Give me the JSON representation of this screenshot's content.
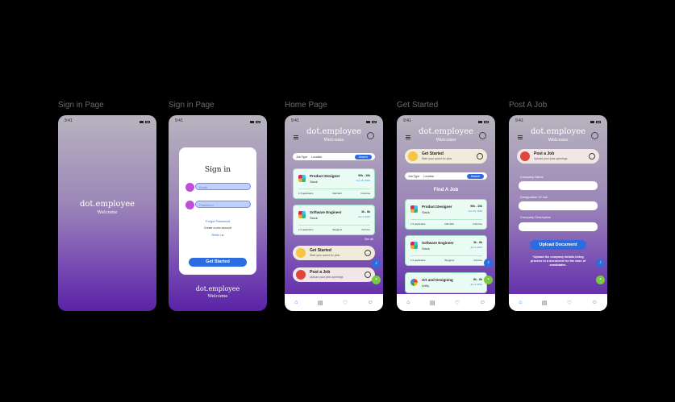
{
  "frames": [
    {
      "title": "Sign in Page"
    },
    {
      "title": "Sign in Page"
    },
    {
      "title": "Home Page"
    },
    {
      "title": "Get Started"
    },
    {
      "title": "Post A Job"
    }
  ],
  "status_time": "9:41",
  "brand": {
    "name": "dot.employee",
    "tagline": "Welcome"
  },
  "signin": {
    "heading": "Sign in",
    "email_placeholder": "Email",
    "password_placeholder": "Password",
    "forgot": "Forgot Password",
    "create": "Create a new account",
    "refer": "Refer us",
    "cta": "Get Started"
  },
  "filter": {
    "job_type": "Job Type",
    "location": "Location",
    "search": "Search"
  },
  "jobs": [
    {
      "title": "Product Designer",
      "company": "Slack",
      "price": "90k - 10k",
      "date": "Jun 19, 2024",
      "applicants": "1.5 applicants",
      "level": "Mid-Skill",
      "mode": "Full-time"
    },
    {
      "title": "Software Engineer",
      "company": "Slack",
      "price": "3k - 8k",
      "date": "Jun 4 2024",
      "applicants": "1.6 applicants",
      "level": "Begginer",
      "mode": "full-time"
    },
    {
      "title": "Art and Designing",
      "company": "Artify",
      "price": "8k - 8k",
      "date": "Jun 4 2024"
    }
  ],
  "see_all": "See All",
  "get_started": {
    "title": "Get Started",
    "subtitle": "Start your quest for jobs"
  },
  "post_job": {
    "title": "Post a Job",
    "subtitle": "Upload your jobs openings"
  },
  "find_job": "Find A Job",
  "post_form": {
    "company_name": "Company Name",
    "designation": "Designation Of Job",
    "description": "Company Description",
    "upload": "Upload Document",
    "note": "*Upload the company details,hiring process in a document for the ease of candidates."
  },
  "tabs": [
    "home-icon",
    "document-icon",
    "heart-icon",
    "user-icon"
  ],
  "colors": {
    "accent": "#2b6de0",
    "gradient_bottom": "#5a22a6",
    "card_green": "#e9fbf3"
  }
}
